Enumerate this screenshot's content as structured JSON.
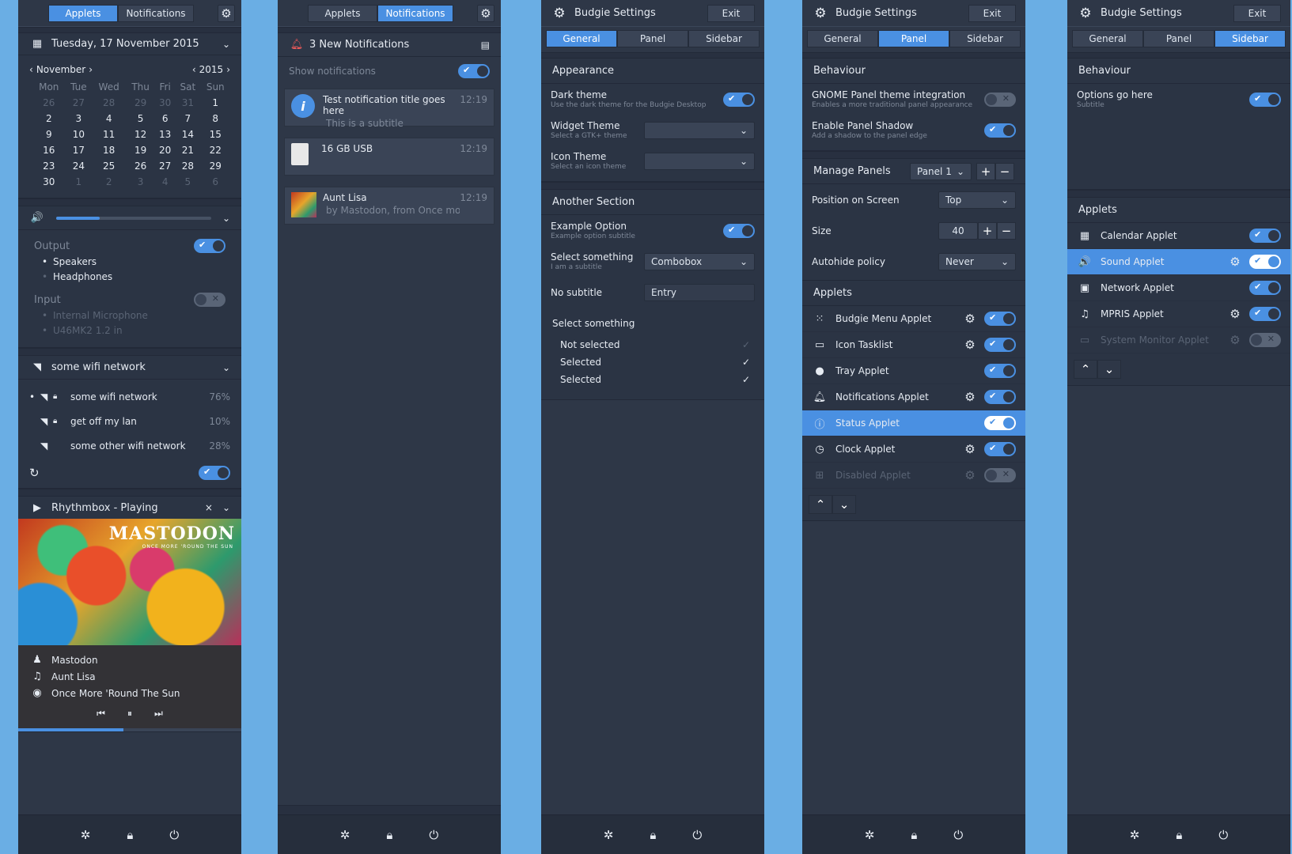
{
  "p1": {
    "tabs": [
      "Applets",
      "Notifications"
    ],
    "date": "Tuesday, 17 November 2015",
    "month": "November",
    "year": "2015",
    "weekdays": [
      "Mon",
      "Tue",
      "Wed",
      "Thu",
      "Fri",
      "Sat",
      "Sun"
    ],
    "cal": [
      [
        "26",
        "27",
        "28",
        "29",
        "30",
        "31",
        "1"
      ],
      [
        "2",
        "3",
        "4",
        "5",
        "6",
        "7",
        "8"
      ],
      [
        "9",
        "10",
        "11",
        "12",
        "13",
        "14",
        "15"
      ],
      [
        "16",
        "17",
        "18",
        "19",
        "20",
        "21",
        "22"
      ],
      [
        "23",
        "24",
        "25",
        "26",
        "27",
        "28",
        "29"
      ],
      [
        "30",
        "1",
        "2",
        "3",
        "4",
        "5",
        "6"
      ]
    ],
    "volume_fraction": 0.28,
    "output": "Output",
    "outputs": [
      "Speakers",
      "Headphones"
    ],
    "input": "Input",
    "inputs": [
      "Internal Microphone",
      "U46MK2 1.2 in"
    ],
    "wifi": "some wifi network",
    "networks": [
      {
        "n": "some wifi network",
        "p": "76%"
      },
      {
        "n": "get off my lan",
        "p": "10%"
      },
      {
        "n": "some other wifi network",
        "p": "28%"
      }
    ],
    "player": "Rhythmbox - Playing",
    "album_text": "MASTODON",
    "album_sub": "ONCE MORE 'ROUND THE SUN",
    "artist": "Mastodon",
    "track": "Aunt Lisa",
    "album": "Once More 'Round The Sun",
    "progress_fraction": 0.47
  },
  "p2": {
    "tabs": [
      "Applets",
      "Notifications"
    ],
    "title": "3 New Notifications",
    "show": "Show notifications",
    "n": [
      {
        "t": "Test notification title goes here",
        "s": "This is a subtitle",
        "time": "12:19"
      },
      {
        "t": "16 GB USB",
        "s": "",
        "time": "12:19"
      },
      {
        "t": "Aunt Lisa",
        "s": "by Mastodon, from Once mor...",
        "time": "12:19"
      }
    ]
  },
  "settings": {
    "title": "Budgie Settings",
    "exit": "Exit",
    "tabs": [
      "General",
      "Panel",
      "Sidebar"
    ]
  },
  "p3": {
    "appearance": "Appearance",
    "rows": [
      {
        "l": "Dark theme",
        "s": "Use the dark theme for the Budgie Desktop"
      },
      {
        "l": "Widget Theme",
        "s": "Select a GTK+ theme"
      },
      {
        "l": "Icon Theme",
        "s": "Select an icon theme"
      }
    ],
    "another": "Another Section",
    "ex": {
      "l": "Example Option",
      "s": "Example option subtitle"
    },
    "sel": {
      "l": "Select something",
      "s": "I am a subtitle",
      "v": "Combobox"
    },
    "nosub": {
      "l": "No subtitle",
      "v": "Entry"
    },
    "sel2": "Select something",
    "list": [
      "Not selected",
      "Selected",
      "Selected"
    ]
  },
  "p4": {
    "behaviour": "Behaviour",
    "gnome": {
      "l": "GNOME Panel theme integration",
      "s": "Enables a more traditional panel appearance"
    },
    "shadow": {
      "l": "Enable Panel Shadow",
      "s": "Add a shadow to the panel edge"
    },
    "manage": "Manage Panels",
    "panel": "Panel 1",
    "pos": {
      "l": "Position on Screen",
      "v": "Top"
    },
    "size": {
      "l": "Size",
      "v": "40"
    },
    "auto": {
      "l": "Autohide policy",
      "v": "Never"
    },
    "applets": "Applets",
    "list": [
      "Budgie Menu Applet",
      "Icon Tasklist",
      "Tray Applet",
      "Notifications Applet",
      "Status Applet",
      "Clock Applet",
      "Disabled Applet"
    ]
  },
  "p5": {
    "behaviour": "Behaviour",
    "opt": {
      "l": "Options go here",
      "s": "Subtitle"
    },
    "applets": "Applets",
    "list": [
      "Calendar Applet",
      "Sound Applet",
      "Network Applet",
      "MPRIS Applet",
      "System Monitor Applet"
    ]
  },
  "icons": {
    "gear": "gear-icon",
    "calendar": "calendar-icon",
    "volume": "volume-icon",
    "wifi": "wifi-icon",
    "lock": "lock-icon",
    "bell": "bell-icon",
    "play": "play-icon",
    "settings": "settings-icon",
    "power": "power-icon"
  },
  "colors": {
    "accent": "#4a90e2",
    "panel": "#2e3747",
    "background": "#6aaee4",
    "bell": "#f05a5a"
  }
}
